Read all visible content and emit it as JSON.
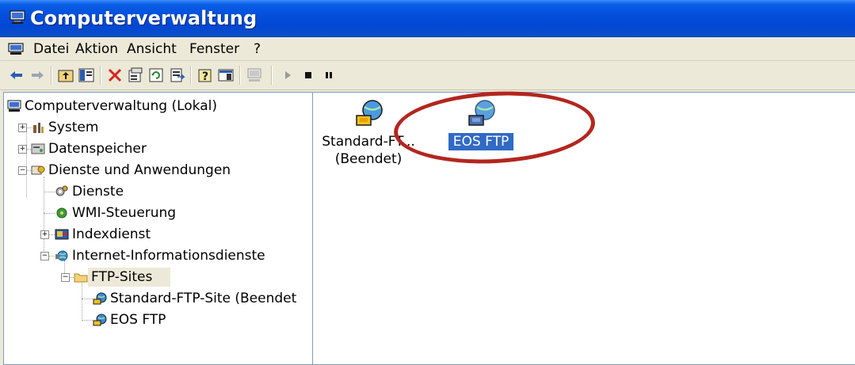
{
  "window": {
    "title": "Computerverwaltung"
  },
  "menu": {
    "items": [
      "Datei",
      "Aktion",
      "Ansicht",
      "Fenster",
      "?"
    ]
  },
  "toolbar": {
    "buttons": [
      "back-arrow",
      "forward-arrow",
      "up-folder",
      "show-hide-tree",
      "delete",
      "properties",
      "refresh",
      "export-list",
      "help",
      "console-view",
      "computer",
      "play",
      "stop",
      "pause"
    ]
  },
  "tree": {
    "root": "Computerverwaltung (Lokal)",
    "system": "System",
    "storage": "Datenspeicher",
    "services_apps": "Dienste und Anwendungen",
    "services": "Dienste",
    "wmi": "WMI-Steuerung",
    "indexing": "Indexdienst",
    "iis": "Internet-Informationsdienste",
    "ftp_sites": "FTP-Sites",
    "site_standard": "Standard-FTP-Site (Beendet",
    "site_eos": "EOS FTP"
  },
  "content": {
    "item_standard_line1": "Standard-FT...",
    "item_standard_line2": "(Beendet)",
    "item_eos": "EOS FTP"
  },
  "colors": {
    "title_bar": "#0350dc",
    "selection": "#316ac5",
    "highlight_circle": "#b3261e"
  }
}
